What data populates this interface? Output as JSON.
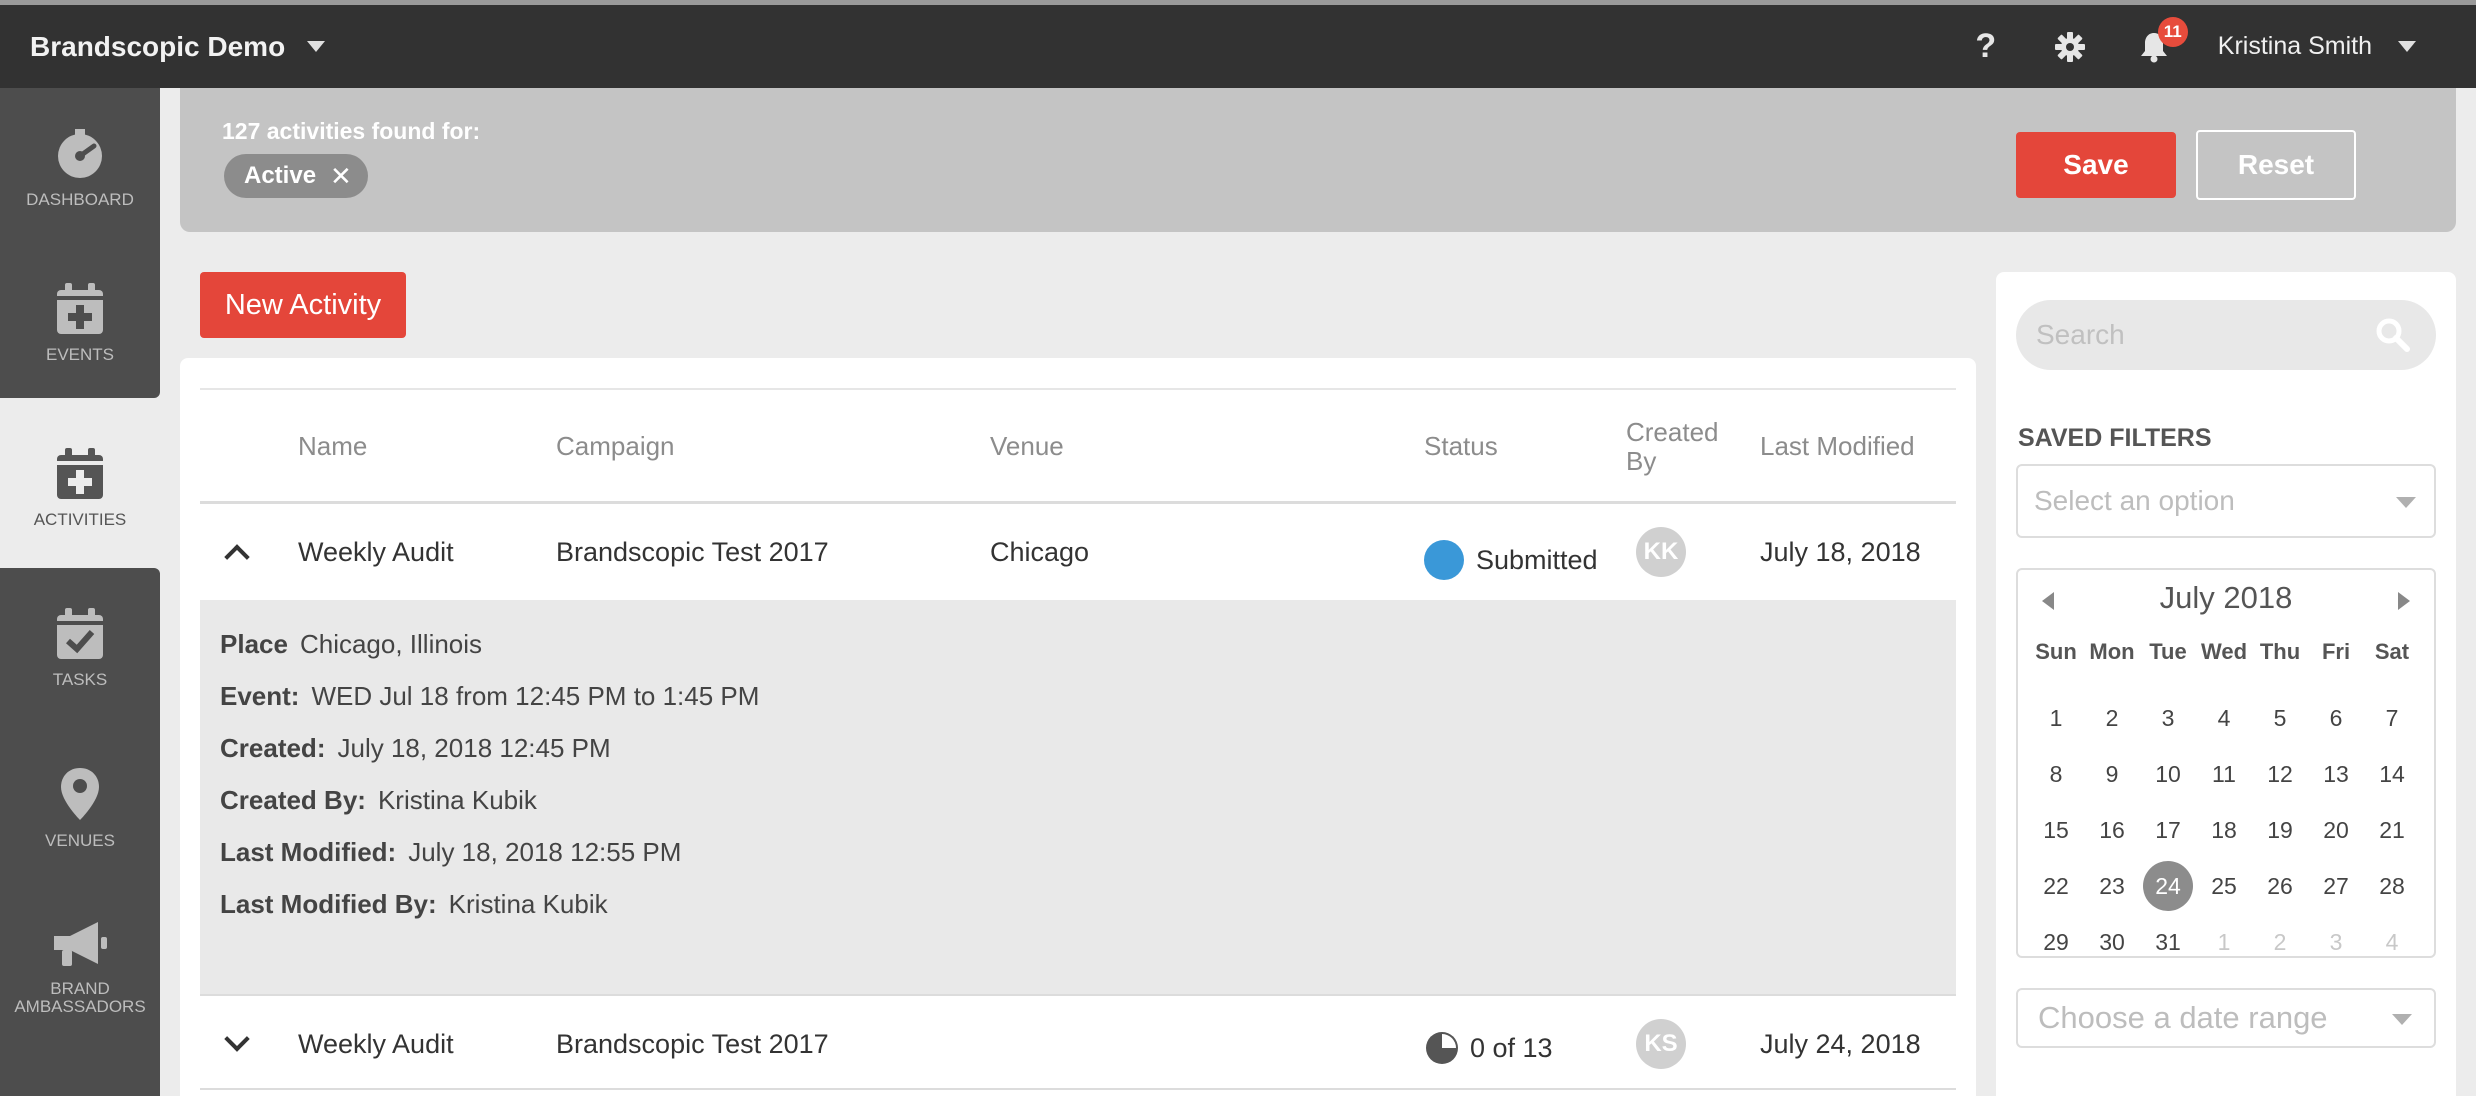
{
  "topbar": {
    "brand": "Brandscopic Demo",
    "help_label": "?",
    "notification_count": "11",
    "user_name": "Kristina Smith"
  },
  "nav": [
    {
      "label": "DASHBOARD",
      "icon": "dashboard-gauge-icon"
    },
    {
      "label": "EVENTS",
      "icon": "calendar-plus-icon"
    },
    {
      "label": "ACTIVITIES",
      "icon": "calendar-plus-icon",
      "active": true
    },
    {
      "label": "TASKS",
      "icon": "calendar-check-icon"
    },
    {
      "label": "VENUES",
      "icon": "map-pin-icon"
    },
    {
      "label": "BRAND AMBASSADORS",
      "icon": "megaphone-icon"
    }
  ],
  "filter": {
    "found_text": "127 activities found for:",
    "chip_label": "Active",
    "chip_remove": "✕",
    "save_label": "Save",
    "reset_label": "Reset"
  },
  "actions": {
    "new_activity": "New Activity"
  },
  "table": {
    "columns": [
      "Name",
      "Campaign",
      "Venue",
      "Status",
      "Created By",
      "Last Modified"
    ],
    "rows": [
      {
        "name": "Weekly Audit",
        "campaign": "Brandscopic Test 2017",
        "venue": "Chicago",
        "status": "Submitted",
        "created_by_initials": "KK",
        "last_modified": "July 18, 2018",
        "expanded": true
      },
      {
        "name": "Weekly Audit",
        "campaign": "Brandscopic Test 2017",
        "venue": "",
        "status": "0 of 13",
        "created_by_initials": "KS",
        "last_modified": "July 24, 2018",
        "expanded": false
      }
    ],
    "details": [
      {
        "key": "Place",
        "value": "Chicago, Illinois"
      },
      {
        "key": "Event:",
        "value": "WED Jul 18 from 12:45 PM to 1:45 PM"
      },
      {
        "key": "Created:",
        "value": "July 18, 2018 12:45 PM"
      },
      {
        "key": "Created By:",
        "value": "Kristina Kubik"
      },
      {
        "key": "Last Modified:",
        "value": "July 18, 2018 12:55 PM"
      },
      {
        "key": "Last Modified By:",
        "value": "Kristina Kubik"
      }
    ]
  },
  "sidebar": {
    "search_placeholder": "Search",
    "saved_filters_label": "SAVED FILTERS",
    "saved_filters_placeholder": "Select an option",
    "calendar": {
      "month_label": "July 2018",
      "weekdays": [
        "Sun",
        "Mon",
        "Tue",
        "Wed",
        "Thu",
        "Fri",
        "Sat"
      ],
      "days": [
        "1",
        "2",
        "3",
        "4",
        "5",
        "6",
        "7",
        "8",
        "9",
        "10",
        "11",
        "12",
        "13",
        "14",
        "15",
        "16",
        "17",
        "18",
        "19",
        "20",
        "21",
        "22",
        "23",
        "24",
        "25",
        "26",
        "27",
        "28",
        "29",
        "30",
        "31",
        "1",
        "2",
        "3",
        "4"
      ],
      "muted_from_index": 31,
      "today": "24"
    },
    "date_range_placeholder": "Choose a date range"
  },
  "colors": {
    "accent_red": "#e4463a",
    "status_submitted": "#3a98d8",
    "topbar": "#323232",
    "nav_dark": "#4d4d4d"
  }
}
